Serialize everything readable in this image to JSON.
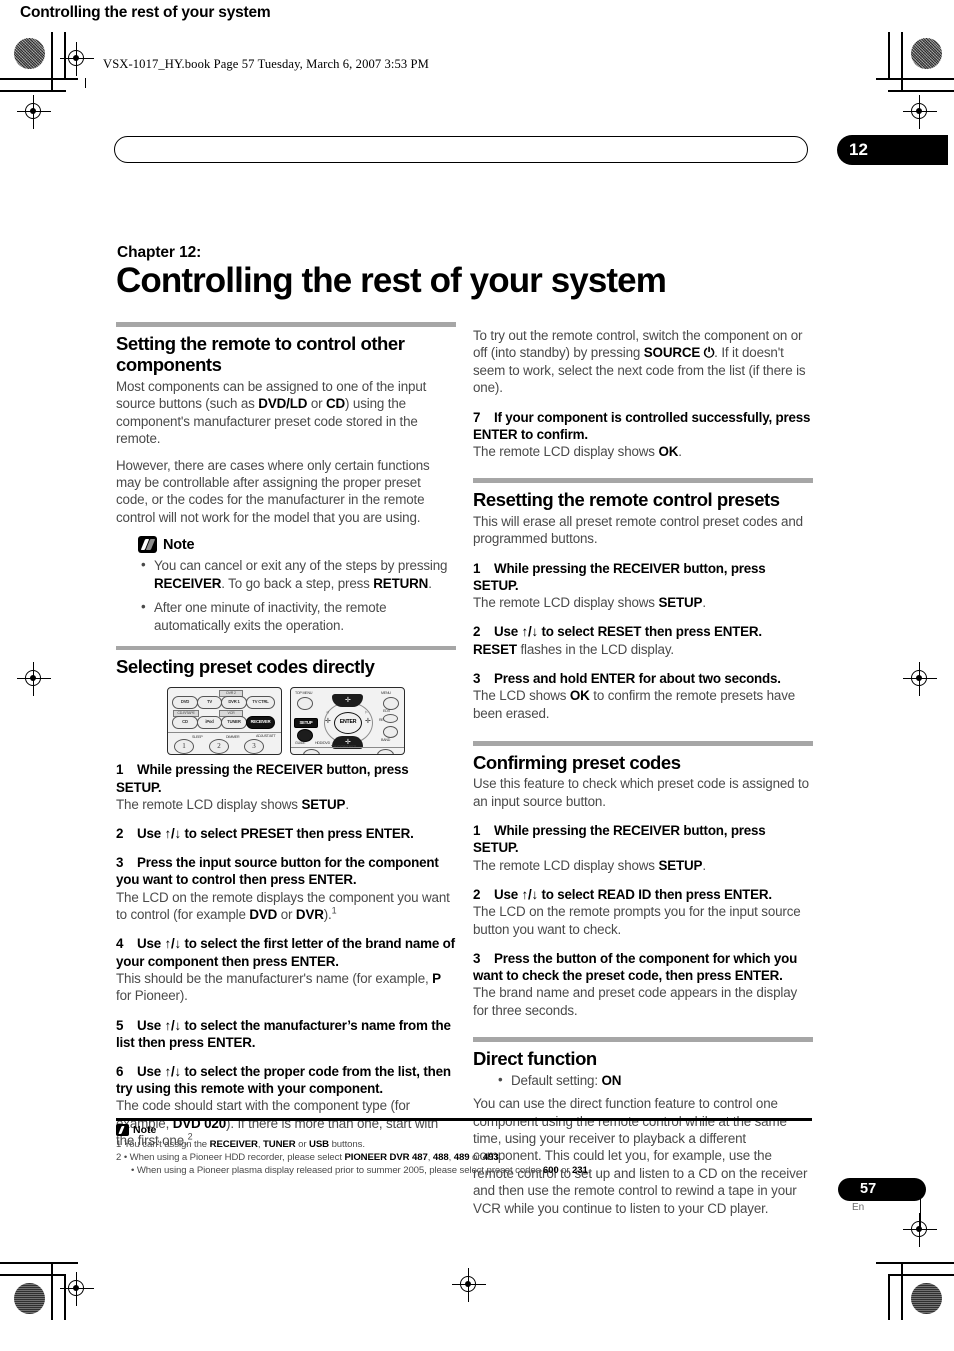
{
  "file_header": "VSX-1017_HY.book  Page 57  Tuesday, March 6, 2007  3:53 PM",
  "running_head": {
    "title": "Controlling the rest of your system",
    "chapter_number": "12"
  },
  "chapter": {
    "label": "Chapter 12:",
    "title": "Controlling the rest of your system"
  },
  "left_column": {
    "section1": {
      "heading": "Setting the remote to control other components",
      "para1_a": "Most components can be assigned to one of the input source buttons (such as ",
      "para1_b": "DVD/LD",
      "para1_c": " or ",
      "para1_d": "CD",
      "para1_e": ") using the component's manufacturer preset code stored in the remote.",
      "para2": "However, there are cases where only certain functions may be controllable after assigning the proper preset code, or the codes for the manufacturer in the remote control will not work for the model that you are using."
    },
    "note": {
      "title": "Note",
      "items": [
        {
          "a": "You can cancel or exit any of the steps by pressing ",
          "b": "RECEIVER",
          "c": ". To go back a step, press ",
          "d": "RETURN",
          "e": "."
        },
        {
          "a": "After one minute of inactivity, the remote automatically exits the operation."
        }
      ]
    },
    "section2": {
      "heading": "Selecting preset codes directly",
      "steps": [
        {
          "n": "1",
          "text": "While pressing the RECEIVER button, press SETUP.",
          "result_a": "The remote LCD display shows ",
          "result_b": "SETUP",
          "result_c": "."
        },
        {
          "n": "2",
          "text": "Use ↑/↓ to select PRESET then press ENTER."
        },
        {
          "n": "3",
          "text": "Press the input source button for the component you want to control then press ENTER.",
          "result_a": "The LCD on the remote displays the component you want to control (for example ",
          "result_b": "DVD",
          "result_c": " or ",
          "result_d": "DVR",
          "result_e": ").",
          "result_sup": "1"
        },
        {
          "n": "4",
          "text": "Use ↑/↓ to select the first letter of the brand name of your component then press ENTER.",
          "result_a": "This should be the manufacturer's name (for example, ",
          "result_b": "P",
          "result_c": " for Pioneer)."
        },
        {
          "n": "5",
          "text": "Use ↑/↓ to select the manufacturer’s name from the list then press ENTER."
        },
        {
          "n": "6",
          "text": "Use ↑/↓ to select the proper code from the list, then try using this remote with your component.",
          "result_a": "The code should start with the component type (for example, ",
          "result_b": "DVD 020",
          "result_c": "). If there is more than one, start with the first one.",
          "result_sup": "2"
        }
      ]
    },
    "remote_figure": {
      "panel_left": {
        "source_buttons": [
          "DVD",
          "TV",
          "DVR 1",
          "TV CTRL",
          "CD",
          "iPod",
          "TUNER",
          "RECEIVER"
        ],
        "mini_labels": [
          "DVR 2",
          "CD-R/TAPE",
          "VCR"
        ],
        "number_keys": [
          "1",
          "2",
          "3"
        ],
        "number_sublabels": [
          "SLEEP",
          "DIMMER",
          "ADJUST/ATT"
        ]
      },
      "panel_right": {
        "top_menu": "TOP MENU",
        "menu": "MENU",
        "setup": "SETUP",
        "enter": "ENTER",
        "guide": "GUIDE",
        "hdd_dvd": "HDD/DVD",
        "tv_control": "TV CONTROL",
        "edit": "EDIT",
        "return": "RETURN",
        "band": "BAND"
      }
    }
  },
  "right_column": {
    "intro": {
      "para_a": "To try out the remote control, switch the component on or off (into standby) by pressing ",
      "para_b": "SOURCE ⏻",
      "para_c": ". If it doesn't seem to work, select the next code from the list (if there is one)."
    },
    "step7": {
      "n": "7",
      "text": "If your component is controlled successfully, press ENTER to confirm.",
      "result_a": "The remote LCD display shows ",
      "result_b": "OK",
      "result_c": "."
    },
    "section_reset": {
      "heading": "Resetting the remote control presets",
      "intro": "This will erase all preset remote control preset codes and programmed buttons.",
      "steps": [
        {
          "n": "1",
          "text": "While pressing the RECEIVER button, press SETUP.",
          "result_a": "The remote LCD display shows ",
          "result_b": "SETUP",
          "result_c": "."
        },
        {
          "n": "2",
          "text": "Use ↑/↓ to select RESET then press ENTER.",
          "result_a": "",
          "result_b": "RESET",
          "result_c": " flashes in the LCD display."
        },
        {
          "n": "3",
          "text": "Press and hold ENTER for about two seconds.",
          "result_a": "The LCD shows ",
          "result_b": "OK",
          "result_c": " to confirm the remote presets have been erased."
        }
      ]
    },
    "section_confirm": {
      "heading": "Confirming preset codes",
      "intro": "Use this feature to check which preset code is assigned to an input source button.",
      "steps": [
        {
          "n": "1",
          "text": "While pressing the RECEIVER button, press SETUP.",
          "result_a": "The remote LCD display shows ",
          "result_b": "SETUP",
          "result_c": "."
        },
        {
          "n": "2",
          "text": "Use ↑/↓ to select READ ID then press ENTER.",
          "result_a": "The LCD on the remote prompts you for the input source button you want to check."
        },
        {
          "n": "3",
          "text": "Press the button of the component for which you want to check the preset code, then press ENTER.",
          "result_a": "The brand name and preset code appears in the display for three seconds."
        }
      ]
    },
    "section_direct": {
      "heading": "Direct function",
      "bullet_a": "Default setting: ",
      "bullet_b": "ON",
      "para": "You can use the direct function feature to control one component using the remote control while at the same time, using your receiver to playback a different component. This could let you, for example, use the remote control to set up and listen to a CD on the receiver and then use the remote control to rewind a tape in your VCR while you continue to listen to your CD player."
    }
  },
  "footnotes": {
    "title": "Note",
    "line1": {
      "n": "1",
      "a": "You can't assign the ",
      "b": "RECEIVER",
      "c": ", ",
      "d": "TUNER",
      "e": " or ",
      "f": "USB",
      "g": " buttons."
    },
    "line2": {
      "n": "2",
      "a": "• When using a Pioneer HDD recorder, please select ",
      "b": "PIONEER DVR 487",
      "c": ", ",
      "d": "488",
      "e": ", ",
      "f": "489",
      "g": " or ",
      "h": "493",
      "i": "."
    },
    "line3": {
      "a": "• When using a Pioneer plasma display released prior to summer 2005, please select preset codes ",
      "b": "600",
      "c": " or ",
      "d": "231",
      "e": "."
    }
  },
  "page_footer": {
    "number": "57",
    "language": "En"
  }
}
